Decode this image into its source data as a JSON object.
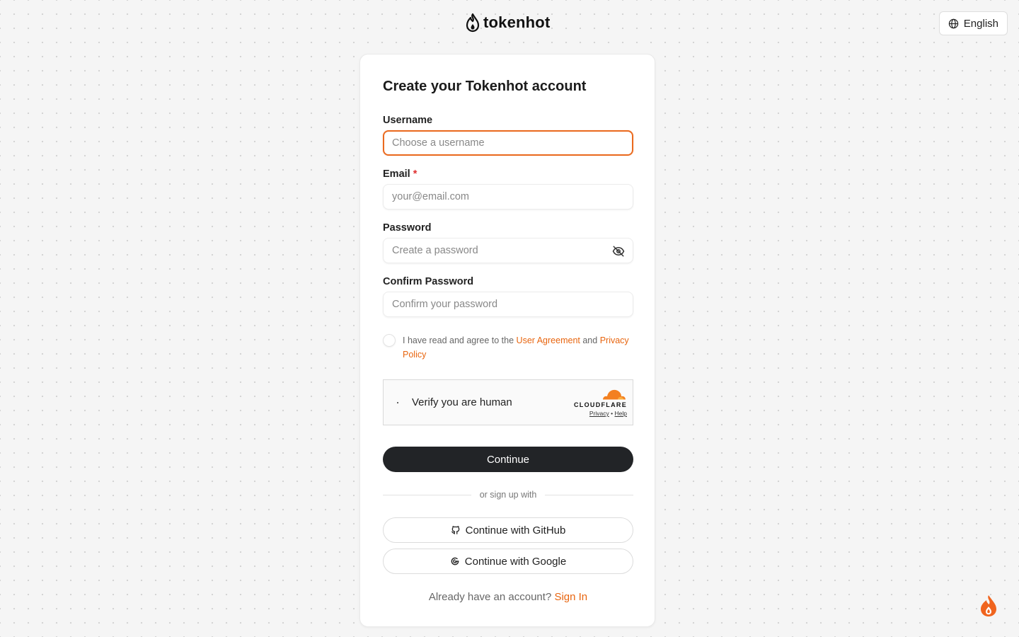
{
  "brand": {
    "name": "tokenhot"
  },
  "language": {
    "label": "English"
  },
  "form": {
    "title": "Create your Tokenhot account",
    "username": {
      "label": "Username",
      "placeholder": "Choose a username",
      "value": ""
    },
    "email": {
      "label": "Email",
      "required_mark": "*",
      "placeholder": "your@email.com",
      "value": ""
    },
    "password": {
      "label": "Password",
      "placeholder": "Create a password",
      "value": ""
    },
    "confirm_password": {
      "label": "Confirm Password",
      "placeholder": "Confirm your password",
      "value": ""
    },
    "agreement": {
      "prefix": "I have read and agree to the",
      "user_agreement": "User Agreement",
      "and": "and",
      "privacy_policy": "Privacy Policy",
      "checked": false
    },
    "captcha": {
      "text": "Verify you are human",
      "brand": "CLOUDFLARE",
      "privacy": "Privacy",
      "separator": "•",
      "help": "Help"
    },
    "continue_label": "Continue",
    "divider_text": "or sign up with",
    "github_label": "Continue with GitHub",
    "google_label": "Continue with Google",
    "signin_prompt": "Already have an account?",
    "signin_link": "Sign In"
  },
  "colors": {
    "accent": "#ea6a1f",
    "primary_button": "#222427",
    "cloudflare_orange": "#f38020"
  },
  "icons": {
    "logo": "flame-logo-icon",
    "language": "globe-icon",
    "password_toggle": "eye-off-icon",
    "github": "github-icon",
    "google": "google-icon",
    "captcha_brand": "cloudflare-cloud-icon",
    "corner": "flame-icon"
  }
}
